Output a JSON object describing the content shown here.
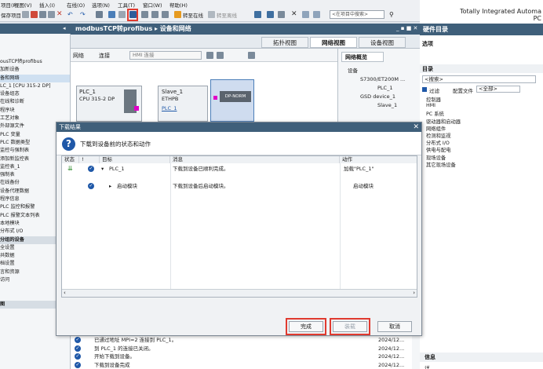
{
  "menu": {
    "project": "项目(P)",
    "edit": "编辑(E)",
    "view": "视图(V)",
    "insert": "插入(I)",
    "online": "在线(O)",
    "options": "选项(N)",
    "tools": "工具(T)",
    "window": "窗口(W)",
    "help": "帮助(H)"
  },
  "toolbar": {
    "save_project": "保存项目",
    "go_online": "转至在线",
    "go_offline": "转至离线",
    "search_placeholder": "<在项目中搜索>"
  },
  "brand": {
    "line1": "Totally Integrated Automa",
    "line2": "PC"
  },
  "left_tree": {
    "items": [
      "",
      "",
      "",
      "ousTCP转profibus",
      "加新设备",
      "备和网络",
      "LC_1 [CPU 315-2 DP]",
      "设备组态",
      "在线和诊断",
      "程序块",
      "工艺对象",
      "外部源文件",
      "PLC 变量",
      "PLC 数据类型",
      "监控与强制表",
      "添加新监控表",
      "监控表_1",
      "强制表",
      "在线备份",
      "设备代理数据",
      "程序信息",
      "PLC 监控和报警",
      "PLC 报警文本列表",
      "本地模块",
      "分布式 I/O",
      "分组的设备",
      "全设置",
      "共数据",
      "档设置",
      "言和资源",
      "访问",
      "",
      "",
      "图"
    ]
  },
  "editor": {
    "title": "modbusTCP转profibus ▸ 设备和网络",
    "controls": "_ ▪ ■ ✕",
    "tab_topology": "拓扑视图",
    "tab_network": "网络视图",
    "tab_device": "设备视图",
    "network": "网络",
    "connections": "连接",
    "connection_type": "HMI 连接"
  },
  "devices": {
    "plc_name": "PLC_1",
    "plc_type": "CPU 315-2 DP",
    "plc_link": "PLC_1",
    "slave_name": "Slave_1",
    "slave_type": "ETHPB",
    "slave_link": "PLC_1",
    "slave_module": "DP-NORM"
  },
  "overview": {
    "tab": "网络概览",
    "col": "设备",
    "rows": [
      "S7300/ET200M ...",
      "PLC_1",
      "GSD device_1",
      "Slave_1"
    ]
  },
  "right": {
    "title": "硬件目录",
    "options": "选项",
    "catalog": "目录",
    "search_placeholder": "<搜索>",
    "filter": "过滤",
    "profile_label": "配置文件",
    "profile_value": "<全部>",
    "items": [
      "控制器",
      "HMI",
      "PC 系统",
      "驱动器和启动器",
      "网络组件",
      "检测和监视",
      "分布式 I/O",
      "供电与配电",
      "现场设备",
      "其它现场设备"
    ],
    "info": "信息",
    "details": "详"
  },
  "dialog": {
    "title": "下载结果",
    "subtitle": "下载到设备前的状态和动作",
    "columns": [
      "状态",
      "!",
      "目标",
      "消息",
      "动作"
    ],
    "rows": [
      {
        "target": "PLC_1",
        "message": "下载到设备已顺利完成。",
        "action": "加载\"PLC_1\""
      },
      {
        "target": "启动模块",
        "message": "下载到设备后启动模块。",
        "action": "启动模块"
      }
    ],
    "btn_finish": "完成",
    "btn_load": "装载",
    "btn_cancel": "取消"
  },
  "messages": [
    {
      "text": "已通过地址 MPI=2 连接到 PLC_1。",
      "date": "2024/12..."
    },
    {
      "text": "到 PLC_1 的连接已关闭。",
      "date": "2024/12..."
    },
    {
      "text": "开始下载到设备。",
      "date": "2024/12..."
    },
    {
      "text": "下载到设备完成",
      "date": "2024/12..."
    }
  ],
  "colors": {
    "title_bar": "#3f5f7a",
    "accent_red": "#e03a2f",
    "check_blue": "#1f58a8",
    "module_magenta": "#e000c8"
  }
}
